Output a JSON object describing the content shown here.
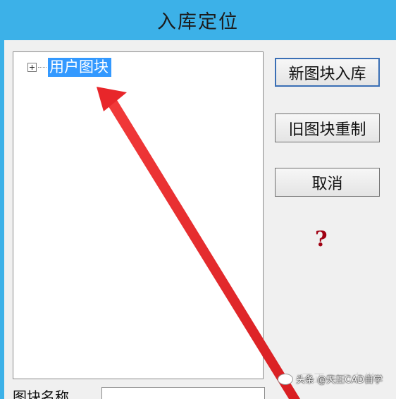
{
  "window": {
    "title": "入库定位"
  },
  "tree": {
    "root_label": "用户图块",
    "root_expander": "plus-icon"
  },
  "buttons": {
    "new_block": "新图块入库",
    "old_block": "旧图块重制",
    "cancel": "取消"
  },
  "help": {
    "glyph": "?"
  },
  "bottom": {
    "name_label": "图块名称",
    "name_value": ""
  },
  "watermark": {
    "text": "头条 @天正CAD自学",
    "behind_text": "天正CAD自学"
  },
  "colors": {
    "titlebar": "#3cb1e8",
    "selection": "#3399ff",
    "arrow": "#e8262a",
    "help": "#a00012"
  }
}
